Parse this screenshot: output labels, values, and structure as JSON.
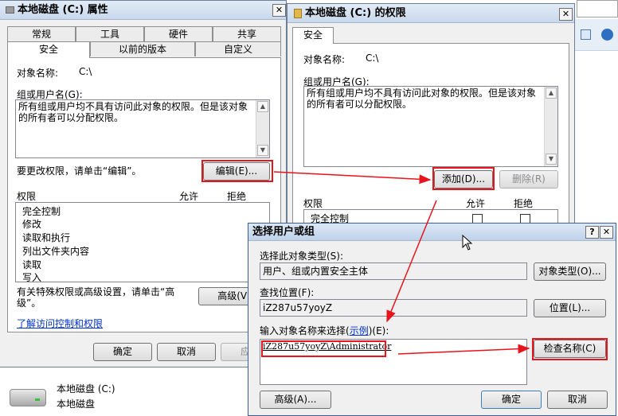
{
  "properties_window": {
    "title": "本地磁盘 (C:) 属性",
    "tabs_row1": [
      "常规",
      "工具",
      "硬件",
      "共享"
    ],
    "tabs_row2": [
      "安全",
      "以前的版本",
      "自定义"
    ],
    "object_name_label": "对象名称:",
    "object_name_value": "C:\\",
    "group_label": "组或用户名(G):",
    "group_text": "所有组或用户均不具有访问此对象的权限。但是该对象的所有者可以分配权限。",
    "change_perm_text": "要更改权限，请单击“编辑”。",
    "edit_button": "编辑(E)...",
    "permissions_label": "权限",
    "allow_label": "允许",
    "deny_label": "拒绝",
    "permissions": [
      "完全控制",
      "修改",
      "读取和执行",
      "列出文件夹内容",
      "读取",
      "写入"
    ],
    "special_text": "有关特殊权限或高级设置，请单击“高级”。",
    "advanced_button": "高级(V)",
    "learn_link": "了解访问控制和权限",
    "ok_button": "确定",
    "cancel_button": "取消",
    "apply_button": "应用"
  },
  "permissions_window": {
    "title": "本地磁盘 (C:) 的权限",
    "tab": "安全",
    "object_name_label": "对象名称:",
    "object_name_value": "C:\\",
    "group_label": "组或用户名(G):",
    "group_text": "所有组或用户均不具有访问此对象的权限。但是该对象的所有者可以分配权限。",
    "add_button": "添加(D)...",
    "remove_button": "删除(R)",
    "permissions_label": "权限",
    "allow_label": "允许",
    "deny_label": "拒绝",
    "first_permission": "完全控制"
  },
  "select_dialog": {
    "title": "选择用户或组",
    "help_button": "?",
    "close_button": "✕",
    "object_type_label": "选择此对象类型(S):",
    "object_type_value": "用户、组或内置安全主体",
    "object_types_button": "对象类型(O)...",
    "location_label": "查找位置(F):",
    "location_value": "iZ287u57yoyZ",
    "locations_button": "位置(L)...",
    "enter_names_label_prefix": "输入对象名称来选择(",
    "enter_names_link": "示例",
    "enter_names_label_suffix": ")(E):",
    "names_value": "iZ287u57yoyZ\\Administrator",
    "check_names_button": "检查名称(C)",
    "advanced_button": "高级(A)...",
    "ok_button": "确定",
    "cancel_button": "取消"
  },
  "drive": {
    "name": "本地磁盘 (C:)",
    "description": "本地磁盘"
  },
  "colors": {
    "highlight_red": "#e8141b",
    "window_bg": "#f0f0f0",
    "link_blue": "#0033cc"
  }
}
